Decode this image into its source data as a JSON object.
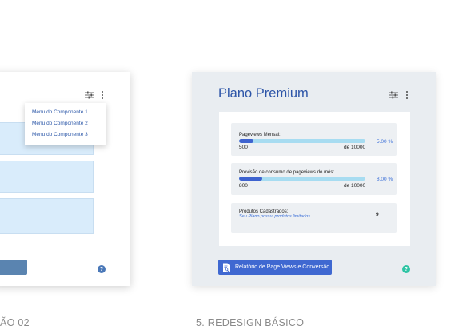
{
  "previous": {
    "menu_items": [
      "Menu do Componente 1",
      "Menu do Componente 2",
      "Menu do Componente 3"
    ],
    "help_label": "?",
    "caption": "ÃO 02"
  },
  "redesign": {
    "title": "Plano Premium",
    "metrics": [
      {
        "label": "Pageviews Mensal:",
        "current": "500",
        "limit": "de 10000",
        "percent_label": "5.00 %",
        "fill_fraction": 0.05
      },
      {
        "label": "Previsão de consumo de pageviews do mês:",
        "current": "800",
        "limit": "de 10000",
        "percent_label": "8.00 %",
        "fill_fraction": 0.08
      }
    ],
    "products": {
      "label": "Produtos Cadastrados:",
      "note": "Seu Plano possui produtos limitados",
      "value": "9"
    },
    "report_button_label": "Relatório de Page Views e Conversão",
    "help_label": "?",
    "caption": "5. REDESIGN BÁSICO"
  },
  "colors": {
    "accent": "#3f68d1",
    "bar_track": "#a7dcf1",
    "help_blue": "#4a78b8",
    "help_teal": "#2ec4a4"
  }
}
